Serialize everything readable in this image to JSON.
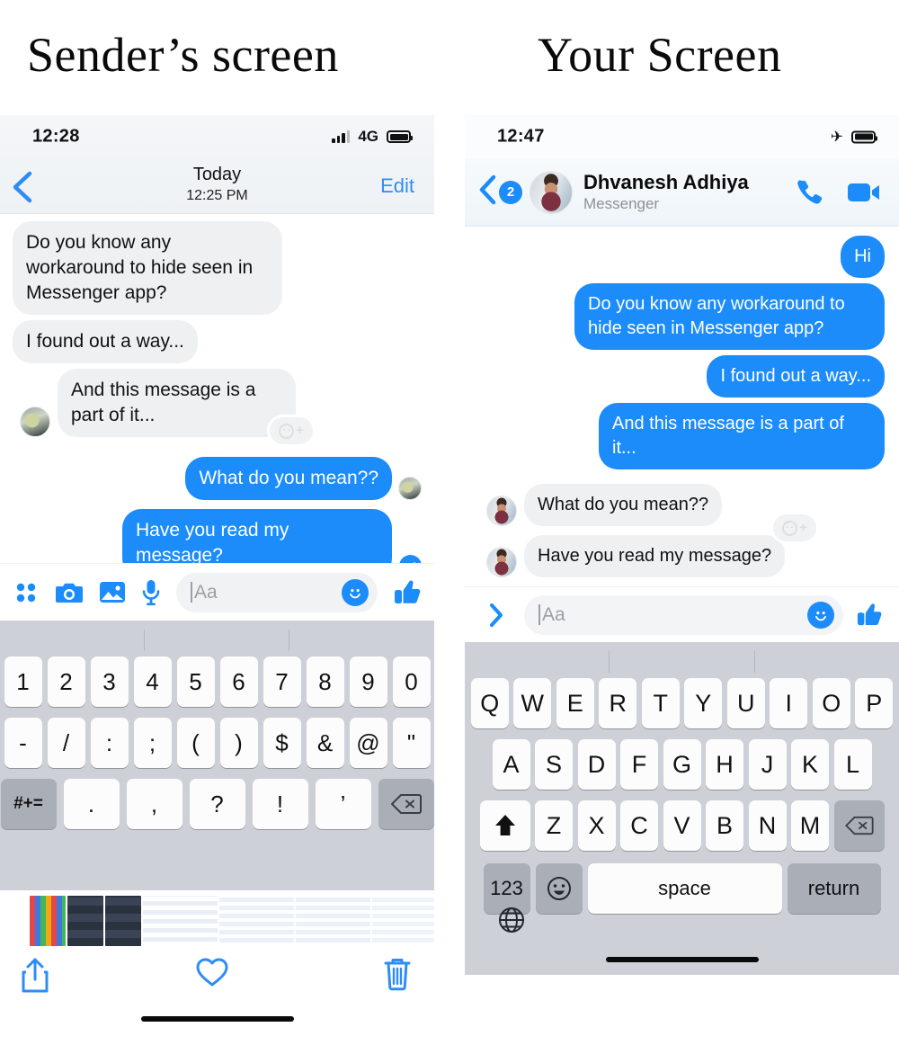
{
  "titles": {
    "left": "Sender’s screen",
    "right": "Your Screen"
  },
  "colors": {
    "accent_blue": "#1b8cf9",
    "link_blue": "#2f8cf7",
    "bubble_gray": "#eff0f1",
    "keyboard_bg": "#cdd0d6",
    "key_white": "#fcfcfd",
    "key_dark": "#a9aeb7"
  },
  "left_panel": {
    "status_bar": {
      "time": "12:28",
      "network": "4G",
      "signal_icon": "signal-bars-icon",
      "battery_icon": "battery-full-icon"
    },
    "nav": {
      "back_icon": "chevron-left-icon",
      "title": "Today",
      "subtitle": "12:25 PM",
      "edit_label": "Edit"
    },
    "messages": [
      {
        "id": "m1",
        "side": "in",
        "text": "Do you know any workaround to hide seen in Messenger app?",
        "avatar": false
      },
      {
        "id": "m2",
        "side": "in",
        "text": "I found out a way...",
        "avatar": false
      },
      {
        "id": "m3",
        "side": "in",
        "text": "And this message is a part of it...",
        "avatar": true,
        "avatar_name": "scene-avatar"
      },
      {
        "id": "m4",
        "side": "out",
        "text": "What do you mean??",
        "trailing": "scene-avatar"
      },
      {
        "id": "m5",
        "side": "out",
        "text": "Have you read my message?",
        "trailing": "read-check-icon"
      }
    ],
    "reaction_pill": {
      "emoji_icon": "smiley-outline-icon",
      "plus": "+"
    },
    "composer": {
      "icons": [
        "four-dots-grid-icon",
        "camera-icon",
        "photo-icon",
        "microphone-icon"
      ],
      "input_placeholder": "Aa",
      "emoji_icon": "smiley-filled-icon",
      "like_icon": "thumbs-up-icon"
    },
    "keyboard": {
      "type": "numeric-symbols",
      "rows": [
        [
          "1",
          "2",
          "3",
          "4",
          "5",
          "6",
          "7",
          "8",
          "9",
          "0"
        ],
        [
          "-",
          "/",
          ":",
          ";",
          "(",
          ")",
          "$",
          "&",
          "@",
          "\""
        ],
        [
          "#+=",
          ".",
          ",",
          "?",
          "!",
          "’",
          "backspace-icon"
        ]
      ]
    },
    "photo_tray": {
      "thumbnails": [
        "thumb-app-grid",
        "thumb-dark-keyboard-1",
        "thumb-dark-keyboard-2",
        "thumb-article-1",
        "thumb-article-2",
        "thumb-article-3",
        "thumb-article-4"
      ],
      "actions": [
        "share-icon",
        "heart-icon",
        "trash-icon"
      ]
    }
  },
  "right_panel": {
    "status_bar": {
      "time": "12:47",
      "airplane_icon": "airplane-mode-icon",
      "battery_icon": "battery-full-icon"
    },
    "nav": {
      "back_icon": "chevron-left-icon",
      "unread_badge": "2",
      "avatar_name": "dhvanesh-avatar",
      "peer_name": "Dhvanesh Adhiya",
      "peer_subtitle": "Messenger",
      "call_icon": "phone-icon",
      "video_icon": "video-camera-icon"
    },
    "messages": [
      {
        "id": "r1",
        "side": "out",
        "text": "Hi"
      },
      {
        "id": "r2",
        "side": "out",
        "text": "Do you know any workaround to hide seen in Messenger app?"
      },
      {
        "id": "r3",
        "side": "out",
        "text": "I found out a way..."
      },
      {
        "id": "r4",
        "side": "out",
        "text": "And this message is a part of it..."
      },
      {
        "id": "r5",
        "side": "in",
        "text": "What do you mean??",
        "avatar": true
      },
      {
        "id": "r6",
        "side": "in",
        "text": "Have you read my message?",
        "avatar": true
      }
    ],
    "reaction_pill": {
      "emoji_icon": "smiley-outline-icon",
      "plus": "+"
    },
    "composer": {
      "expand_icon": "chevron-right-icon",
      "input_placeholder": "Aa",
      "emoji_icon": "smiley-filled-icon",
      "like_icon": "thumbs-up-icon"
    },
    "keyboard": {
      "type": "qwerty",
      "row1": [
        "Q",
        "W",
        "E",
        "R",
        "T",
        "Y",
        "U",
        "I",
        "O",
        "P"
      ],
      "row2": [
        "A",
        "S",
        "D",
        "F",
        "G",
        "H",
        "J",
        "K",
        "L"
      ],
      "row3": [
        "shift-icon",
        "Z",
        "X",
        "C",
        "V",
        "B",
        "N",
        "M",
        "backspace-icon"
      ],
      "row4": {
        "numbers": "123",
        "emoji": "emoji-face-icon",
        "space": "space",
        "return": "return"
      },
      "globe_icon": "globe-icon"
    }
  }
}
